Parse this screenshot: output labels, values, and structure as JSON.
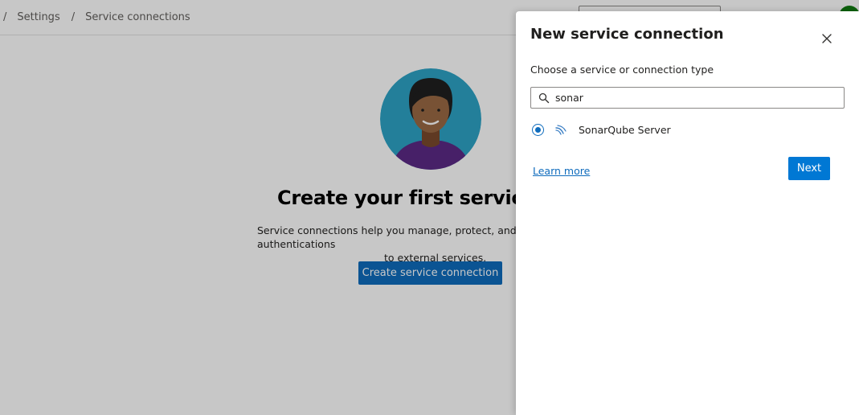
{
  "breadcrumb": {
    "separator": "/",
    "items": [
      {
        "label": "Settings"
      },
      {
        "label": "Service connections"
      }
    ]
  },
  "hero": {
    "title": "Create your first service connection",
    "description_line1": "Service connections help you manage, protect, and reuse authentications",
    "description_line2": "to external services.",
    "create_button_label": "Create service connection"
  },
  "panel": {
    "title": "New service connection",
    "subtitle": "Choose a service or connection type",
    "search": {
      "value": "sonar"
    },
    "results": [
      {
        "label": "SonarQube Server",
        "selected": true,
        "icon": "sonarqube-icon"
      }
    ],
    "learn_more_label": "Learn more",
    "next_button_label": "Next"
  },
  "colors": {
    "accent": "#0078d4",
    "primary_button": "#0f6cbd",
    "avatar_background": "#2ea3c6",
    "avatar_shirt": "#5b2a86",
    "user_badge": "#107c10"
  }
}
